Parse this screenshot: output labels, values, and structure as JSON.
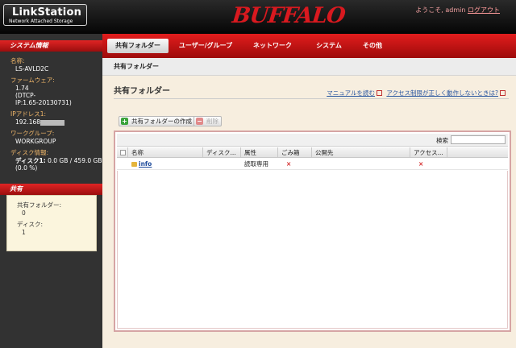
{
  "header": {
    "product": "LinkStation",
    "product_sub": "Network Attached Storage",
    "brand": "BUFFALO",
    "welcome": "ようこそ, admin",
    "logout": "ログアウト"
  },
  "sidebar": {
    "system_heading": "システム情報",
    "info": [
      {
        "label": "名称:",
        "value": "LS-AVLD2C"
      },
      {
        "label": "ファームウェア:",
        "value": "1.74\n(DTCP-\nIP:1.65-20130731)"
      },
      {
        "label": "IPアドレス1:",
        "value": "192.168"
      },
      {
        "label": "ワークグループ:",
        "value": "WORKGROUP"
      },
      {
        "label": "ディスク情報:",
        "value_bold": "ディスク1:",
        "value": " 0.0 GB / 459.0 GB (0.0 %)"
      }
    ],
    "share_heading": "共有",
    "share_items": [
      {
        "label": "共有フォルダー:",
        "value": "0"
      },
      {
        "label": "ディスク:",
        "value": "1"
      }
    ]
  },
  "tabs": [
    {
      "label": "共有フォルダー",
      "active": true
    },
    {
      "label": "ユーザー/グループ",
      "active": false
    },
    {
      "label": "ネットワーク",
      "active": false
    },
    {
      "label": "システム",
      "active": false
    },
    {
      "label": "その他",
      "active": false
    }
  ],
  "main": {
    "breadcrumb": "共有フォルダー",
    "title": "共有フォルダー",
    "help_link_1": "マニュアルを読む",
    "help_link_2": "アクセス制限が正しく動作しないときは?",
    "create_button": "共有フォルダーの作成",
    "delete_button": "削除",
    "search_label": "検索",
    "search_value": "",
    "columns": [
      "名称",
      "ディスク...",
      "属性",
      "ごみ箱",
      "公開先",
      "アクセス..."
    ],
    "rows": [
      {
        "name": "info",
        "disk": "",
        "attribute": "読取専用",
        "trash": "×",
        "publish": "",
        "access": "×"
      }
    ]
  },
  "colors": {
    "accent_red": "#d9191f",
    "sidebar_bg": "#323232",
    "page_bg": "#f7eedf",
    "label_orange": "#f2b86a"
  }
}
